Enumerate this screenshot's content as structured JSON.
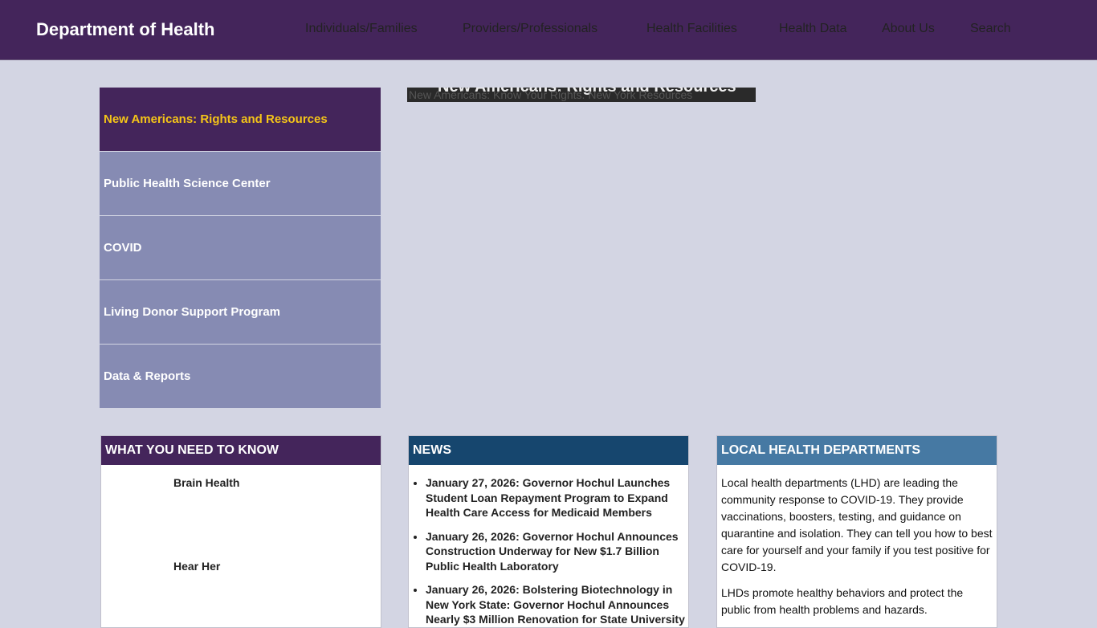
{
  "header": {
    "brand": "Department of Health",
    "nav": [
      "Individuals/Families",
      "Providers/Professionals",
      "Health Facilities",
      "Health Data",
      "About Us",
      "Search"
    ]
  },
  "features": [
    "New Americans: Rights and Resources",
    "Public Health Science Center",
    "COVID",
    "Living Donor Support Program",
    "Data & Reports"
  ],
  "hero": {
    "title": "New Americans: Rights and Resources",
    "alt": "New Americans: Know Your Rights. New York Resources"
  },
  "know": {
    "title": "WHAT YOU NEED TO KNOW",
    "items": [
      "Brain Health",
      "Hear Her"
    ]
  },
  "news": {
    "title": "NEWS",
    "items": [
      "January 27, 2026: Governor Hochul Launches Student Loan Repayment Program to Expand Health Care Access for Medicaid Members",
      "January 26, 2026: Governor Hochul Announces Construction Underway for New $1.7 Billion Public Health Laboratory",
      "January 26, 2026: Bolstering Biotechnology in New York State: Governor Hochul Announces Nearly $3 Million Renovation for State University"
    ]
  },
  "lhd": {
    "title": "LOCAL HEALTH DEPARTMENTS",
    "p1": "Local health departments (LHD) are leading the community response to COVID-19. They provide vaccinations, boosters, testing, and guidance on quarantine and isolation. They can tell you how to best care for yourself and your family if you test positive for COVID-19.",
    "p2": "LHDs promote healthy behaviors and protect the public from health problems and hazards."
  },
  "colors": {
    "header": "#44255b",
    "active_text": "#f5c518",
    "menu_item": "#868bb3",
    "news_head": "#16466e",
    "lhd_head": "#4679a3",
    "background": "#d3d5e3"
  }
}
